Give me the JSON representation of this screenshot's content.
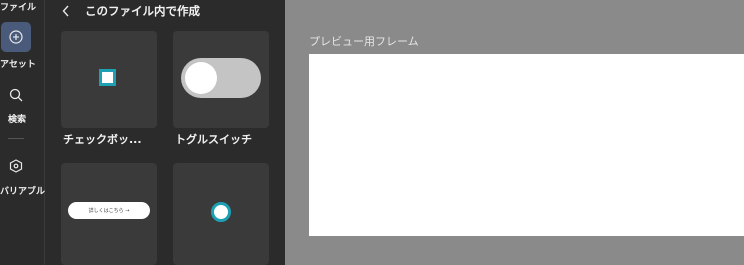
{
  "sidebar": {
    "file_label": "ファイル",
    "assets_label": "アセット",
    "search_label": "検索",
    "variables_label": "バリアブル"
  },
  "panel": {
    "title": "このファイル内で作成",
    "cards": [
      {
        "label": "チェックボッ..."
      },
      {
        "label": "トグルスイッチ"
      },
      {
        "label": "",
        "preview_text": "詳しくはこちら →"
      },
      {
        "label": ""
      }
    ]
  },
  "canvas": {
    "frame_label": "プレビュー用フレーム"
  },
  "colors": {
    "accent": "#1ea0b4",
    "rail_active": "#4a5a7a",
    "panel_bg": "#2b2b2b",
    "card_bg": "#3a3a3a",
    "canvas_bg": "#8a8a8a"
  }
}
